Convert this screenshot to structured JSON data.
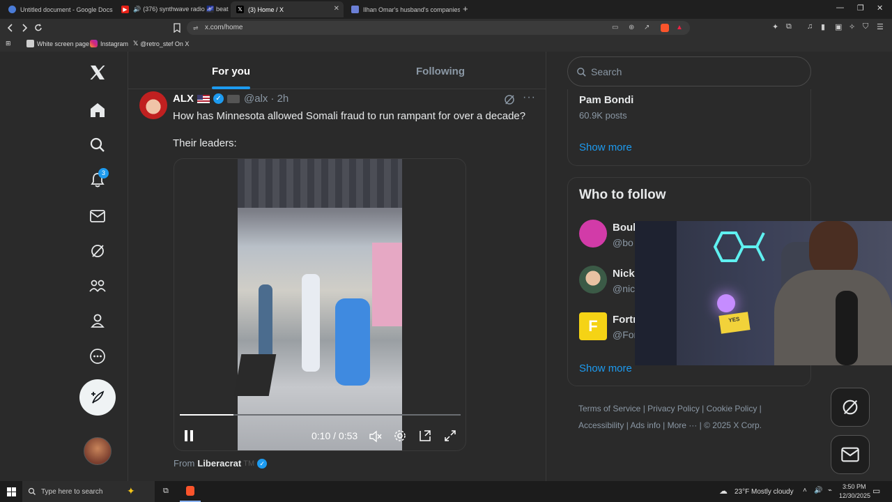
{
  "browser": {
    "tabs": [
      {
        "title": "Untitled document - Google Docs"
      },
      {
        "title": "(376) synthwave radio 🌌 beats to"
      },
      {
        "title": "(3) Home / X"
      },
      {
        "title": "Ilhan Omar's husband's companies s"
      }
    ],
    "url": "x.com/home",
    "bookmarks": [
      "White screen page",
      "Instagram",
      "@retro_stef On X"
    ]
  },
  "nav": {
    "notifications_count": "3"
  },
  "feed": {
    "tabs": {
      "for_you": "For you",
      "following": "Following"
    },
    "post": {
      "name": "ALX",
      "handle": "@alx",
      "time": "· 2h",
      "text1": "How has Minnesota allowed Somali fraud to run rampant for over a decade?",
      "text2": "Their leaders:",
      "video_time": "0:10 / 0:53",
      "progress": 0.19,
      "from_label": "From",
      "from_account": "Liberacrat",
      "from_tm": "TM"
    }
  },
  "right": {
    "search_placeholder": "Search",
    "trend": {
      "name": "Pam Bondi",
      "posts": "60.9K posts"
    },
    "show_more": "Show more",
    "who_to_follow": "Who to follow",
    "follow": [
      {
        "name": "Boub",
        "handle": "@bo"
      },
      {
        "name": "Nick",
        "handle": "@nic"
      },
      {
        "name": "Fortn",
        "handle": "@For"
      }
    ],
    "footer": [
      "Terms of Service",
      "Privacy Policy",
      "Cookie Policy",
      "Accessibility",
      "Ads info",
      "More ···",
      "© 2025 X Corp."
    ]
  },
  "taskbar": {
    "search_placeholder": "Type here to search",
    "weather_temp": "23°F",
    "weather_text": "Mostly cloudy",
    "time": "3:50 PM",
    "date": "12/30/2025"
  },
  "colors": {
    "accent": "#1d9bf0",
    "page_bg": "#2a2a2a"
  }
}
